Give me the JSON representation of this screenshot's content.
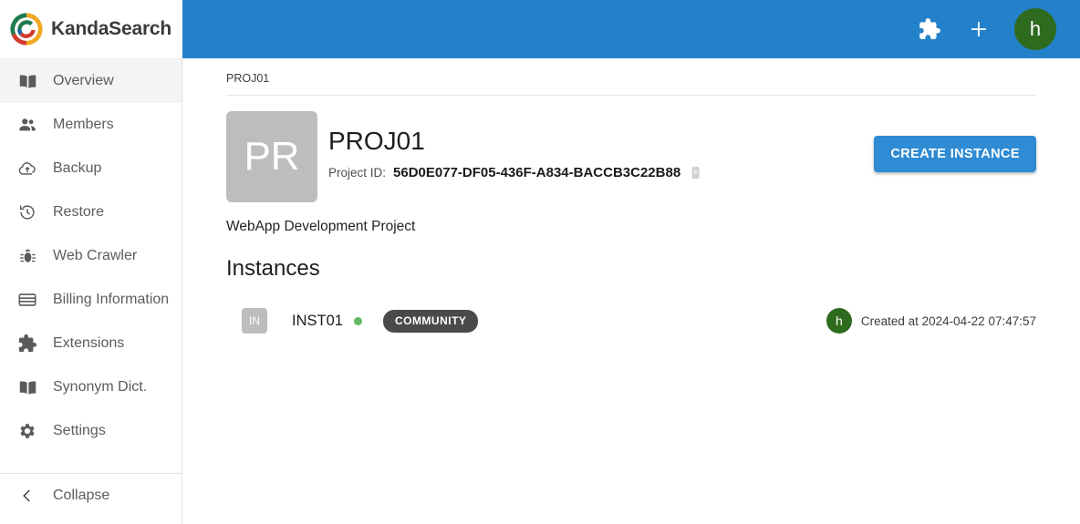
{
  "brand": {
    "name": "KandaSearch",
    "logo_icon": "kandasearch-logo-icon",
    "colors": {
      "header_blue": "#2381c9",
      "button_blue": "#2e8bd4",
      "avatar_green": "#2e6b1e",
      "tile_gray": "#bdbdbd",
      "badge_gray": "#4a4a4a",
      "status_green": "#63ba63"
    }
  },
  "topbar": {
    "extensions_icon": "puzzle-piece-icon",
    "add_icon": "plus-icon",
    "avatar_initial": "h"
  },
  "sidebar": {
    "items": [
      {
        "label": "Overview",
        "icon": "book-icon",
        "active": true
      },
      {
        "label": "Members",
        "icon": "people-icon",
        "active": false
      },
      {
        "label": "Backup",
        "icon": "cloud-upload-icon",
        "active": false
      },
      {
        "label": "Restore",
        "icon": "history-restore-icon",
        "active": false
      },
      {
        "label": "Web Crawler",
        "icon": "bug-icon",
        "active": false
      },
      {
        "label": "Billing Information",
        "icon": "credit-card-icon",
        "active": false
      },
      {
        "label": "Extensions",
        "icon": "puzzle-piece-icon",
        "active": false
      },
      {
        "label": "Synonym Dict.",
        "icon": "open-book-icon",
        "active": false
      },
      {
        "label": "Settings",
        "icon": "gear-icon",
        "active": false
      }
    ],
    "collapse": {
      "label": "Collapse",
      "icon": "chevron-left-icon"
    }
  },
  "main": {
    "breadcrumb": "PROJ01",
    "project": {
      "tile_initials": "PR",
      "title": "PROJ01",
      "id_label": "Project ID:",
      "id_value": "56D0E077-DF05-436F-A834-BACCB3C22B88",
      "copy_icon": "clipboard-copy-icon",
      "description": "WebApp Development Project"
    },
    "create_button": "CREATE INSTANCE",
    "instances_heading": "Instances",
    "instances": [
      {
        "tile_initials": "IN",
        "name": "INST01",
        "status": "online",
        "badge": "COMMUNITY",
        "owner_initial": "h",
        "created": "Created at 2024-04-22 07:47:57"
      }
    ]
  }
}
